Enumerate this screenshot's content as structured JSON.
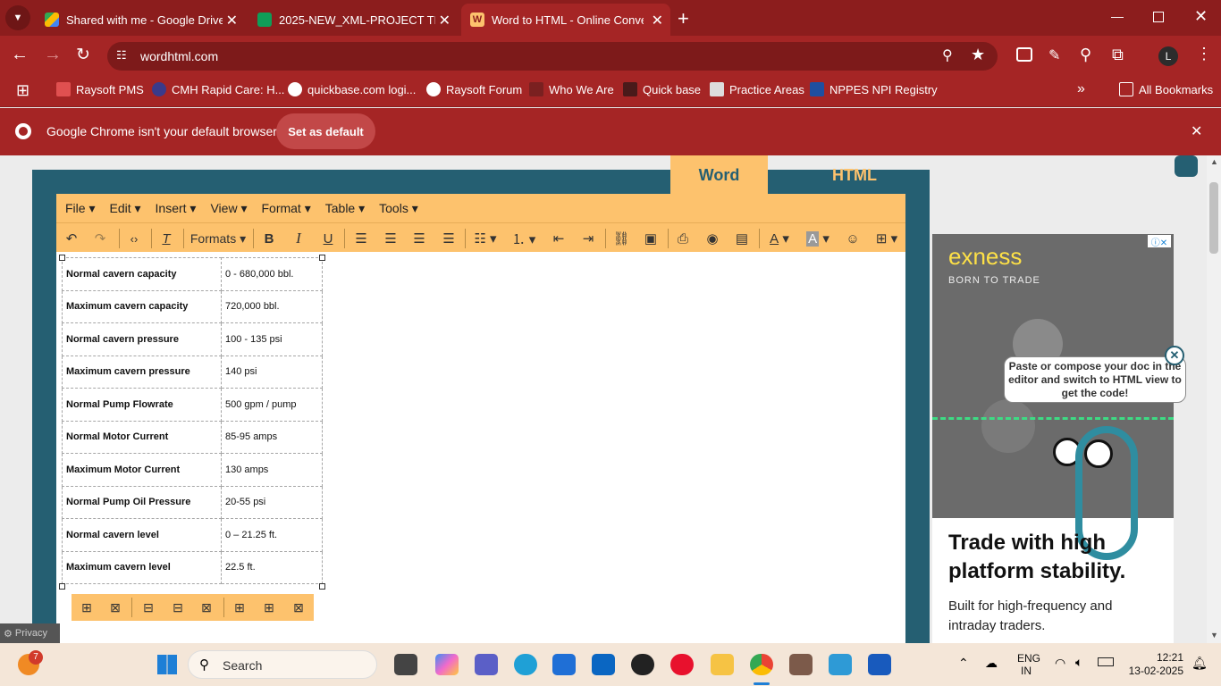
{
  "tabs": [
    {
      "title": "Shared with me - Google Drive",
      "favicon": "google-drive-icon"
    },
    {
      "title": "2025-NEW_XML-PROJECT TRAC",
      "favicon": "google-sheets-icon"
    },
    {
      "title": "Word to HTML - Online Conver",
      "favicon": "wordhtml-icon"
    }
  ],
  "address": "wordhtml.com",
  "profile_initial": "L",
  "bookmarks": [
    "Raysoft PMS",
    "CMH Rapid Care: H...",
    "quickbase.com logi...",
    "Raysoft Forum",
    "Who We Are",
    "Quick base",
    "Practice Areas",
    "NPPES NPI Registry"
  ],
  "all_bookmarks": "All Bookmarks",
  "infobar": {
    "message": "Google Chrome isn't your default browser",
    "button": "Set as default"
  },
  "mode_tabs": {
    "word": "Word",
    "html": "HTML"
  },
  "menus": [
    "File",
    "Edit",
    "Insert",
    "View",
    "Format",
    "Table",
    "Tools"
  ],
  "formats_label": "Formats",
  "table_rows": [
    {
      "key": "Normal cavern capacity",
      "value": "0 - 680,000 bbl."
    },
    {
      "key": "Maximum cavern capacity",
      "value": "720,000 bbl."
    },
    {
      "key": "Normal cavern pressure",
      "value": "100 - 135 psi"
    },
    {
      "key": "Maximum cavern pressure",
      "value": "140 psi"
    },
    {
      "key": "Normal Pump Flowrate",
      "value": "500 gpm / pump"
    },
    {
      "key": "Normal Motor Current",
      "value": "85-95 amps"
    },
    {
      "key": "Maximum Motor Current",
      "value": "130 amps"
    },
    {
      "key": "Normal Pump Oil Pressure",
      "value": "20-55 psi"
    },
    {
      "key": "Normal cavern level",
      "value": "0 – 21.25 ft."
    },
    {
      "key": "Maximum cavern level",
      "value": "22.5 ft."
    }
  ],
  "ad": {
    "brand": "exness",
    "tagline": "BORN TO TRADE",
    "headline": "Trade with high platform stability.",
    "sub": "Built for high-frequency and intraday traders."
  },
  "tooltip": "Paste or compose your doc in the editor and switch to HTML view to get the code!",
  "privacy": "Privacy",
  "taskbar": {
    "search": "Search",
    "weather_badge": "7",
    "lang1": "ENG",
    "lang2": "IN",
    "time": "12:21",
    "date": "13-02-2025"
  }
}
